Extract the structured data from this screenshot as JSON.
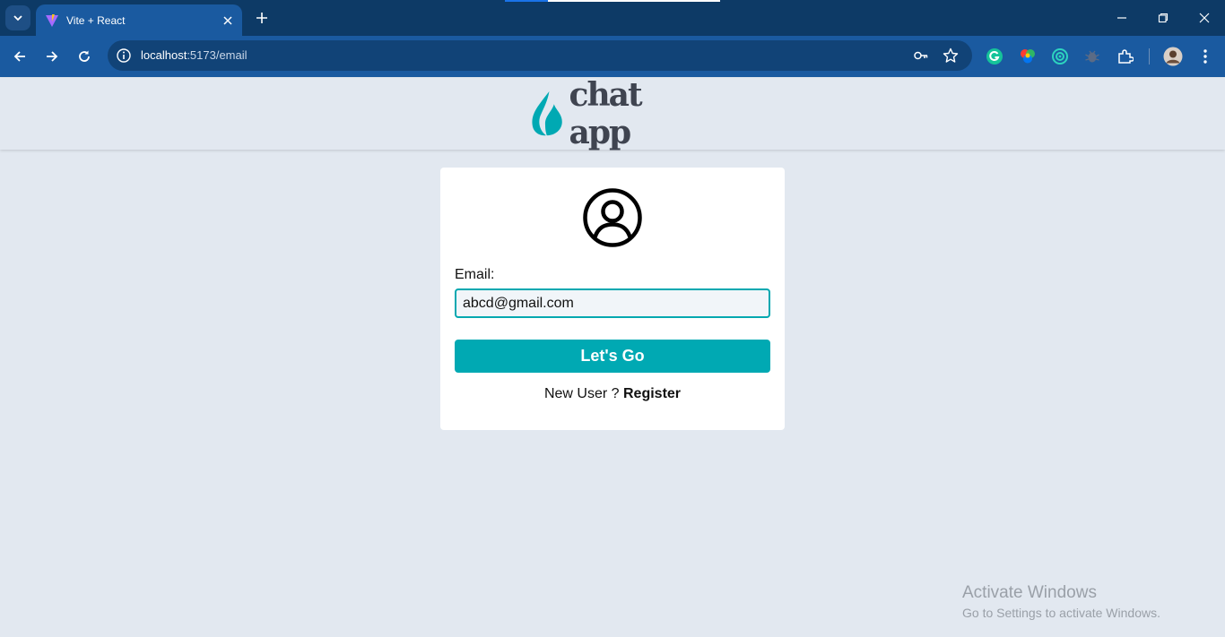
{
  "browser": {
    "tab_title": "Vite + React",
    "url_host": "localhost",
    "url_path": ":5173/email",
    "icons": [
      "tab-search-icon",
      "vite-favicon",
      "close-icon",
      "plus-icon",
      "minimize-icon",
      "restore-icon",
      "window-close-icon",
      "back-arrow-icon",
      "forward-arrow-icon",
      "reload-icon",
      "info-icon",
      "key-icon",
      "star-icon",
      "grammarly-icon",
      "color-picker-icon",
      "target-icon",
      "bug-icon",
      "puzzle-icon",
      "profile-avatar",
      "kebab-menu-icon"
    ]
  },
  "header": {
    "logo_text": "chat app"
  },
  "login": {
    "email_label": "Email:",
    "email_value": "abcd@gmail.com",
    "submit_label": "Let's Go",
    "new_user_text": "New User ? ",
    "register_link": "Register"
  },
  "watermark": {
    "title": "Activate Windows",
    "subtitle": "Go to Settings to activate Windows."
  },
  "colors": {
    "accent": "#00a9b3",
    "browser_frame": "#0d3a66",
    "toolbar": "#1a5aa0",
    "page_bg": "#e2e8f0"
  }
}
